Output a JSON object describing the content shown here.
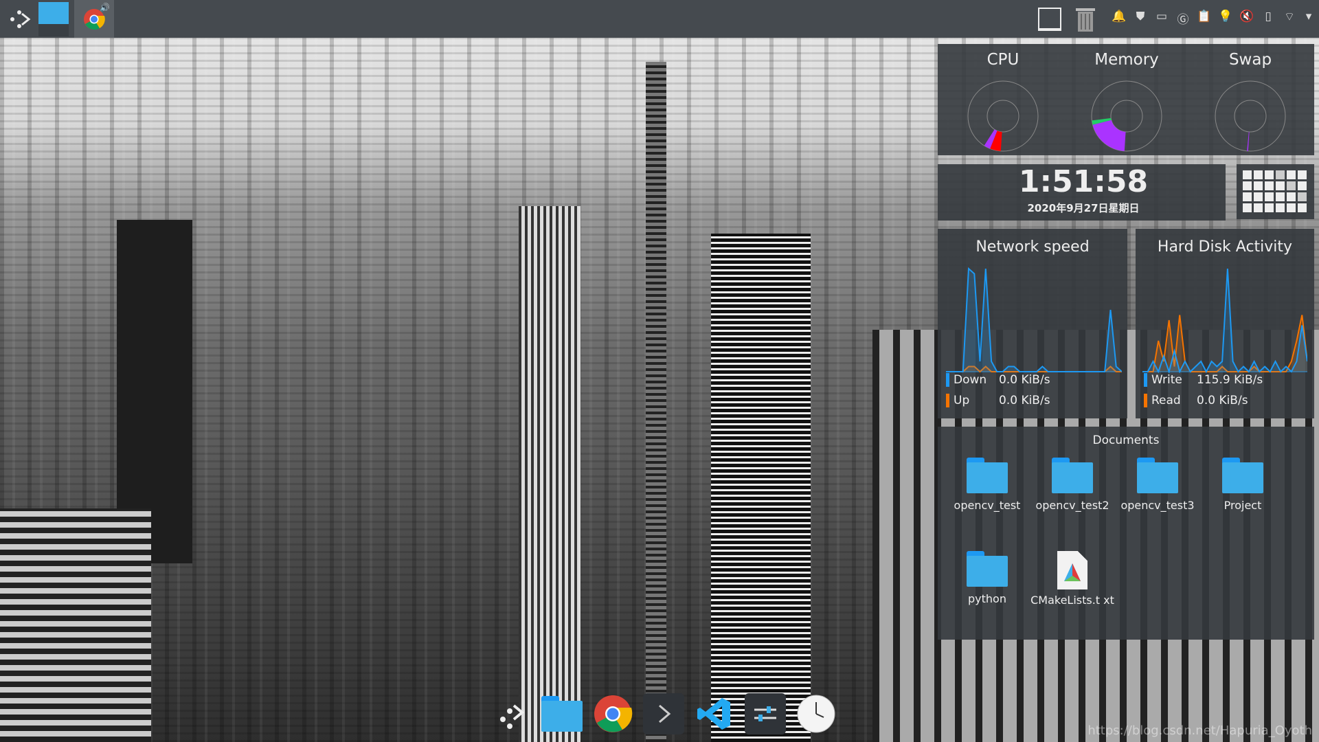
{
  "system_monitor": {
    "gauges": [
      {
        "label": "CPU",
        "segments": [
          {
            "color": "#ff0000",
            "fraction": 0.05
          },
          {
            "color": "#aa33ff",
            "fraction": 0.03
          }
        ]
      },
      {
        "label": "Memory",
        "segments": [
          {
            "color": "#aa33ff",
            "fraction": 0.2
          },
          {
            "color": "#22cc66",
            "fraction": 0.02
          }
        ]
      },
      {
        "label": "Swap",
        "segments": [
          {
            "color": "#aa33ff",
            "fraction": 0.005
          }
        ]
      }
    ]
  },
  "clock": {
    "time": "1:51:58",
    "date": "2020年9月27日星期日"
  },
  "network": {
    "title": "Network speed",
    "down_label": "Down",
    "down_value": "0.0 KiB/s",
    "up_label": "Up",
    "up_value": "0.0 KiB/s",
    "down_color": "#1d99f3",
    "up_color": "#f67400",
    "down_series": [
      0,
      0,
      0,
      0,
      1,
      0.95,
      0.1,
      1,
      0.1,
      0,
      0,
      0.05,
      0.05,
      0,
      0,
      0,
      0,
      0.05,
      0,
      0,
      0,
      0,
      0,
      0,
      0,
      0,
      0,
      0,
      0,
      0.6,
      0.05,
      0
    ],
    "up_series": [
      0,
      0,
      0,
      0,
      0.05,
      0.05,
      0,
      0.05,
      0,
      0,
      0,
      0,
      0,
      0,
      0,
      0,
      0,
      0,
      0,
      0,
      0,
      0,
      0,
      0,
      0,
      0,
      0,
      0,
      0,
      0.05,
      0,
      0
    ]
  },
  "disk": {
    "title": "Hard Disk Activity",
    "write_label": "Write",
    "write_value": "115.9 KiB/s",
    "read_label": "Read",
    "read_value": "0.0 KiB/s",
    "write_color": "#1d99f3",
    "read_color": "#f67400",
    "write_series": [
      0,
      0,
      0.1,
      0,
      0.15,
      0,
      0.2,
      0,
      0.1,
      0,
      0.05,
      0.1,
      0,
      0.1,
      0.05,
      0.1,
      1,
      0.1,
      0,
      0.05,
      0,
      0.1,
      0,
      0.05,
      0,
      0.1,
      0,
      0.05,
      0,
      0.1,
      0.45,
      0.1
    ],
    "read_series": [
      0,
      0,
      0,
      0.3,
      0.1,
      0.5,
      0.05,
      0.55,
      0.1,
      0,
      0,
      0,
      0,
      0,
      0,
      0.05,
      0,
      0,
      0,
      0,
      0,
      0.05,
      0,
      0,
      0,
      0,
      0,
      0,
      0.1,
      0.3,
      0.55,
      0.1
    ]
  },
  "folder_view": {
    "title": "Documents",
    "items": [
      {
        "name": "opencv_test",
        "type": "folder"
      },
      {
        "name": "opencv_test2",
        "type": "folder"
      },
      {
        "name": "opencv_test3",
        "type": "folder"
      },
      {
        "name": "Project",
        "type": "folder"
      },
      {
        "name": "python",
        "type": "folder"
      },
      {
        "name": "CMakeLists.t xt",
        "type": "file"
      }
    ]
  },
  "taskbar": {
    "tray_icons": [
      "notifications-icon",
      "shield-icon",
      "terminal-icon",
      "g-icon",
      "clipboard-icon",
      "bulb-icon",
      "volume-muted-icon",
      "battery-icon",
      "wifi-icon",
      "chevron-down-icon"
    ]
  },
  "dock": {
    "items": [
      "launcher",
      "files",
      "chrome",
      "terminal",
      "vscode",
      "settings",
      "clock"
    ]
  },
  "watermark": "https://blog.csdn.net/Hapuria_Oyoth"
}
